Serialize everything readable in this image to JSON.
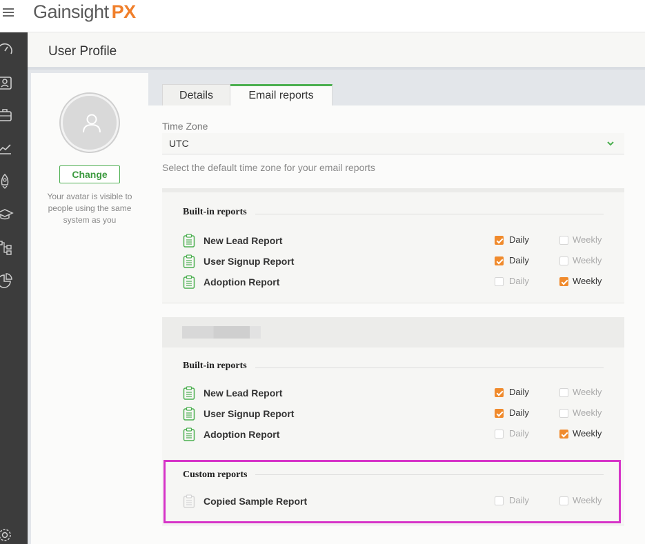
{
  "header": {
    "logo_main": "Gainsight",
    "logo_px": "PX"
  },
  "page": {
    "title": "User Profile"
  },
  "avatar": {
    "change_label": "Change",
    "note": "Your avatar is visible to people using the same system as you"
  },
  "tabs": [
    {
      "label": "Details",
      "active": false
    },
    {
      "label": "Email reports",
      "active": true
    }
  ],
  "timezone": {
    "label": "Time Zone",
    "value": "UTC",
    "help": "Select the default time zone for your email reports"
  },
  "sections": {
    "block1": {
      "title": "Built-in reports",
      "reports": [
        {
          "name": "New Lead Report",
          "daily": true,
          "weekly": false
        },
        {
          "name": "User Signup Report",
          "daily": true,
          "weekly": false
        },
        {
          "name": "Adoption Report",
          "daily": false,
          "weekly": true
        }
      ]
    },
    "block2": {
      "title": "Built-in reports",
      "reports": [
        {
          "name": "New Lead Report",
          "daily": true,
          "weekly": false
        },
        {
          "name": "User Signup Report",
          "daily": true,
          "weekly": false
        },
        {
          "name": "Adoption Report",
          "daily": false,
          "weekly": true
        }
      ],
      "custom_title": "Custom reports",
      "custom_reports": [
        {
          "name": "Copied Sample Report",
          "daily": false,
          "weekly": false
        }
      ]
    }
  },
  "labels": {
    "daily": "Daily",
    "weekly": "Weekly"
  },
  "colors": {
    "accent_green": "#4caf50",
    "checkbox_orange": "#f08a2c",
    "highlight_magenta": "#d633c8",
    "rail": "#3c3c3c"
  }
}
